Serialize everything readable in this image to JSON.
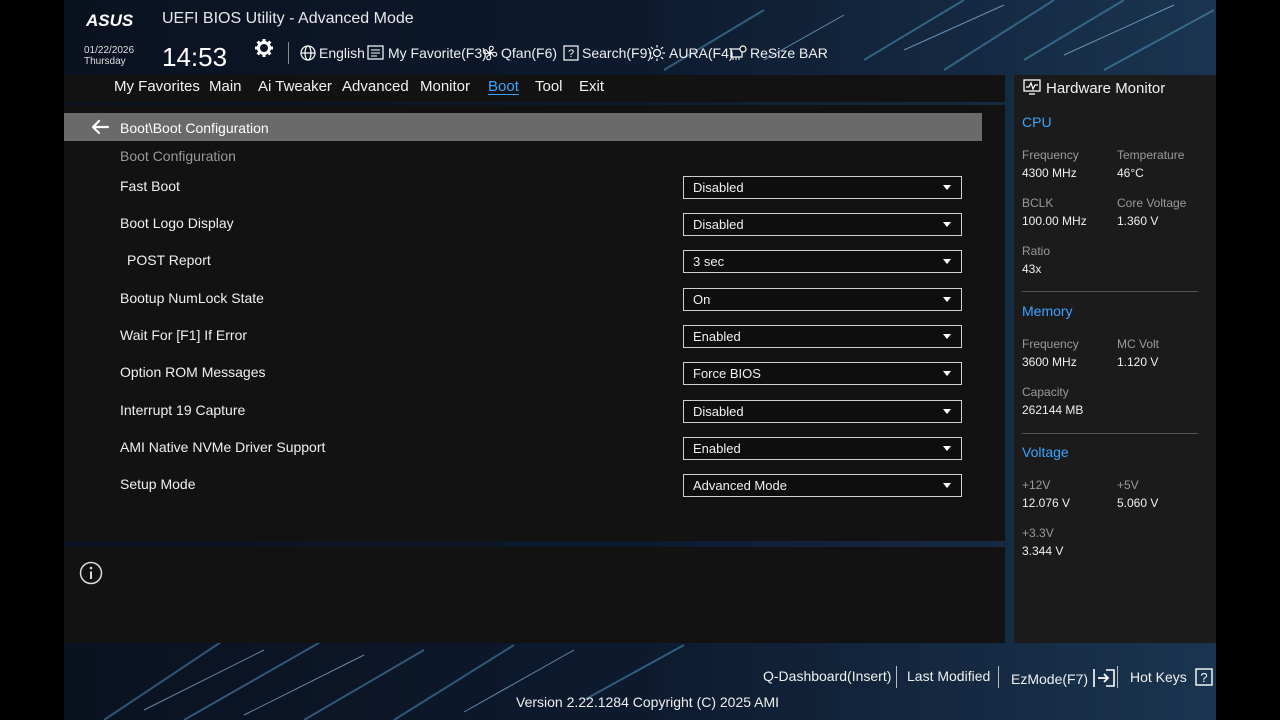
{
  "header": {
    "logo": "ASUS",
    "title": "UEFI BIOS Utility - Advanced Mode",
    "date": "01/22/2026",
    "day": "Thursday",
    "time": "14:53"
  },
  "toolbar": {
    "language": "English",
    "favorite": "My Favorite(F3)",
    "qfan": "Qfan(F6)",
    "search": "Search(F9)",
    "aura": "AURA(F4)",
    "resize_bar": "ReSize BAR"
  },
  "menu": [
    {
      "label": "My Favorites",
      "active": false
    },
    {
      "label": "Main",
      "active": false
    },
    {
      "label": "Ai Tweaker",
      "active": false
    },
    {
      "label": "Advanced",
      "active": false
    },
    {
      "label": "Monitor",
      "active": false
    },
    {
      "label": "Boot",
      "active": true
    },
    {
      "label": "Tool",
      "active": false
    },
    {
      "label": "Exit",
      "active": false
    }
  ],
  "breadcrumb": "Boot\\Boot Configuration",
  "section_label": "Boot Configuration",
  "settings": [
    {
      "label": "Fast Boot",
      "value": "Disabled"
    },
    {
      "label": "Boot Logo Display",
      "value": "Disabled"
    },
    {
      "label": "POST Report",
      "value": "3 sec"
    },
    {
      "label": "Bootup NumLock State",
      "value": "On"
    },
    {
      "label": "Wait For [F1] If Error",
      "value": "Enabled"
    },
    {
      "label": "Option ROM Messages",
      "value": "Force BIOS"
    },
    {
      "label": "Interrupt 19 Capture",
      "value": "Disabled"
    },
    {
      "label": "AMI Native NVMe Driver Support",
      "value": "Enabled"
    },
    {
      "label": "Setup Mode",
      "value": "Advanced Mode"
    }
  ],
  "hw_monitor": {
    "title": "Hardware Monitor",
    "cpu": {
      "heading": "CPU",
      "frequency_label": "Frequency",
      "frequency": "4300 MHz",
      "temperature_label": "Temperature",
      "temperature": "46°C",
      "bclk_label": "BCLK",
      "bclk": "100.00 MHz",
      "core_voltage_label": "Core Voltage",
      "core_voltage": "1.360 V",
      "ratio_label": "Ratio",
      "ratio": "43x"
    },
    "memory": {
      "heading": "Memory",
      "frequency_label": "Frequency",
      "frequency": "3600 MHz",
      "mc_volt_label": "MC Volt",
      "mc_volt": "1.120 V",
      "capacity_label": "Capacity",
      "capacity": "262144 MB"
    },
    "voltage": {
      "heading": "Voltage",
      "v12_label": "+12V",
      "v12": "12.076 V",
      "v5_label": "+5V",
      "v5": "5.060 V",
      "v33_label": "+3.3V",
      "v33": "3.344 V"
    }
  },
  "footer": {
    "q_dashboard": "Q-Dashboard(Insert)",
    "last_modified": "Last Modified",
    "ezmode": "EzMode(F7)",
    "hot_keys": "Hot Keys",
    "version": "Version 2.22.1284 Copyright (C) 2025 AMI"
  },
  "colors": {
    "accent": "#3aa3ff",
    "panel": "#121212",
    "breadcrumb_bar": "#6a6a6a"
  }
}
